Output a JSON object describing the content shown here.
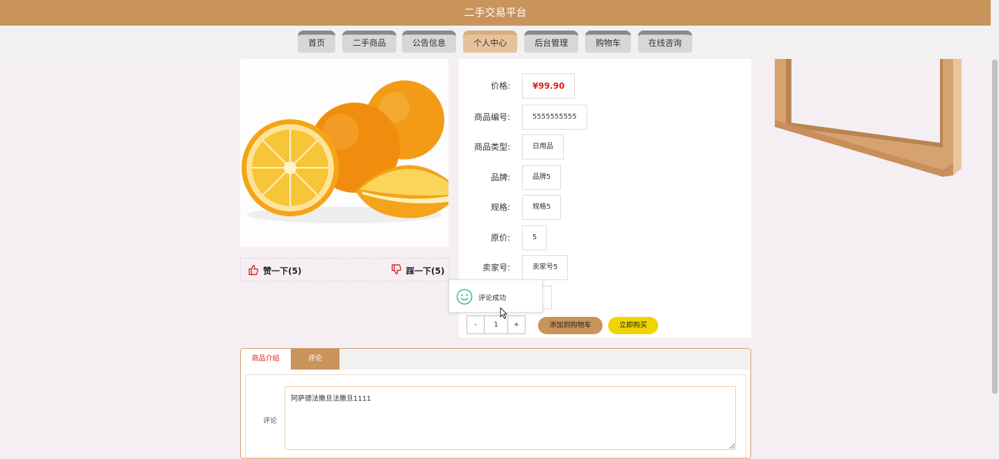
{
  "header": {
    "title": "二手交易平台"
  },
  "nav": {
    "items": [
      "首页",
      "二手商品",
      "公告信息",
      "个人中心",
      "后台管理",
      "购物车",
      "在线咨询"
    ],
    "active": "个人中心"
  },
  "votes": {
    "like": "赞一下(5)",
    "dislike": "踩一下(5)"
  },
  "product": {
    "price_label": "价格:",
    "price": "¥99.90",
    "code_label": "商品编号:",
    "code": "5555555555",
    "type_label": "商品类型:",
    "type": "日用品",
    "brand_label": "品牌:",
    "brand": "品牌5",
    "spec_label": "规格:",
    "spec": "规格5",
    "orig_label": "原价:",
    "orig": "5",
    "seller_label": "卖家号:",
    "seller": "卖家号5"
  },
  "quantity": {
    "minus": "-",
    "value": "1",
    "plus": "+"
  },
  "actions": {
    "add_cart": "添加到购物车",
    "buy_now": "立即购买"
  },
  "toast": {
    "message": "评论成功"
  },
  "tabs": {
    "intro": "商品介绍",
    "comment": "评论"
  },
  "comment": {
    "label": "评论",
    "text": "阿萨德法撒旦法撒旦1111"
  },
  "colors": {
    "brand": "#c9935c",
    "active_nav": "#e6c29b",
    "price": "#d9241b",
    "buy_button": "#f0d400",
    "toast_icon": "#3fbf8f"
  },
  "icons": {
    "like": "thumbs-up-icon",
    "dislike": "thumbs-down-icon",
    "toast": "smile-icon",
    "cursor": "mouse-pointer-icon"
  }
}
